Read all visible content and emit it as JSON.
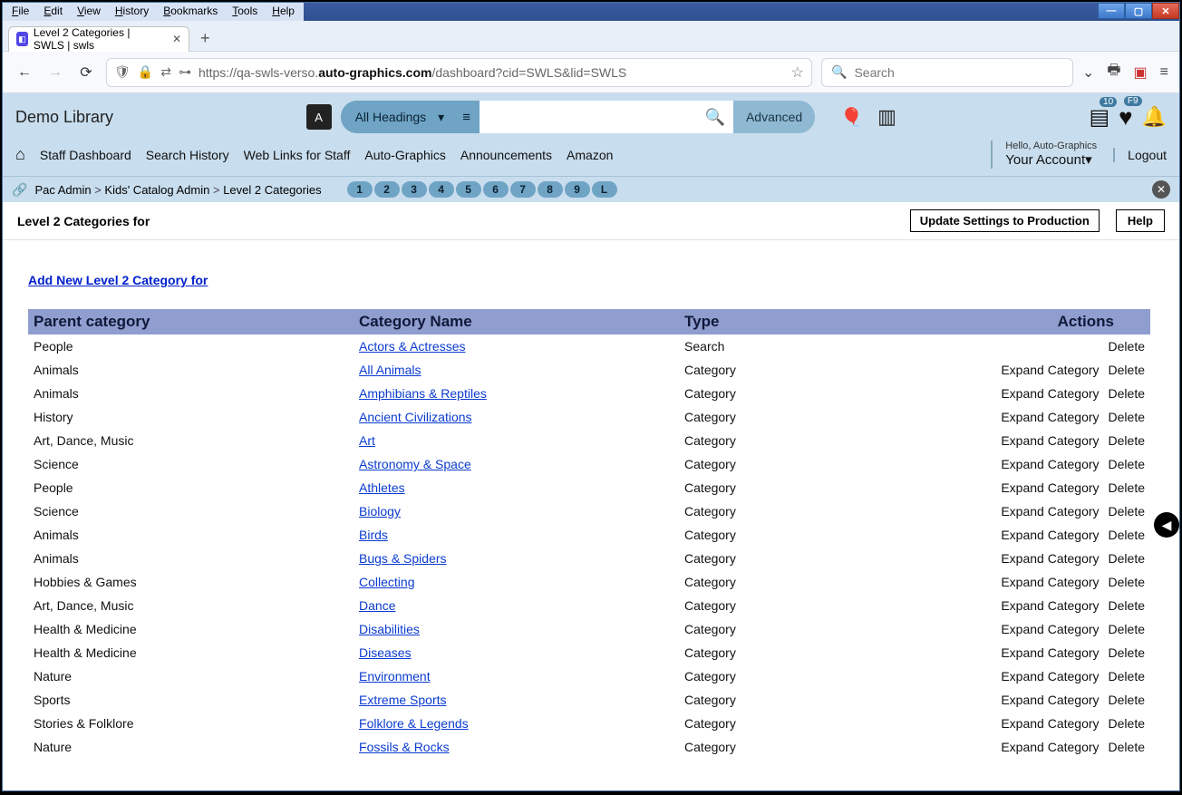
{
  "os_menu": [
    "File",
    "Edit",
    "View",
    "History",
    "Bookmarks",
    "Tools",
    "Help"
  ],
  "tab": {
    "title": "Level 2 Categories | SWLS | swls"
  },
  "url": {
    "prefix": "https://qa-swls-verso.",
    "bold": "auto-graphics.com",
    "suffix": "/dashboard?cid=SWLS&lid=SWLS"
  },
  "browser_search_placeholder": "Search",
  "app": {
    "library_name": "Demo Library",
    "headings_label": "All Headings",
    "advanced_label": "Advanced",
    "badges": {
      "list": "10",
      "fav": "F9"
    }
  },
  "nav_items": [
    "Staff Dashboard",
    "Search History",
    "Web Links for Staff",
    "Auto-Graphics",
    "Announcements",
    "Amazon"
  ],
  "account": {
    "hello": "Hello, Auto-Graphics",
    "your_account": "Your Account▾",
    "logout": "Logout"
  },
  "breadcrumb": [
    "Pac Admin",
    "Kids' Catalog Admin",
    "Level 2 Categories"
  ],
  "pages": [
    "1",
    "2",
    "3",
    "4",
    "5",
    "6",
    "7",
    "8",
    "9",
    "L"
  ],
  "page_title": "Level 2 Categories for",
  "buttons": {
    "update": "Update Settings to Production",
    "help": "Help"
  },
  "add_new": "Add New Level 2 Category for",
  "columns": {
    "parent": "Parent category",
    "name": "Category Name",
    "type": "Type",
    "actions": "Actions"
  },
  "action_labels": {
    "expand": "Expand Category",
    "delete": "Delete"
  },
  "rows": [
    {
      "parent": "People",
      "name": "Actors & Actresses",
      "type": "Search",
      "expand": false
    },
    {
      "parent": "Animals",
      "name": "All Animals",
      "type": "Category",
      "expand": true
    },
    {
      "parent": "Animals",
      "name": "Amphibians & Reptiles",
      "type": "Category",
      "expand": true
    },
    {
      "parent": "History",
      "name": "Ancient Civilizations",
      "type": "Category",
      "expand": true
    },
    {
      "parent": "Art, Dance, Music",
      "name": "Art",
      "type": "Category",
      "expand": true
    },
    {
      "parent": "Science",
      "name": "Astronomy & Space",
      "type": "Category",
      "expand": true
    },
    {
      "parent": "People",
      "name": "Athletes",
      "type": "Category",
      "expand": true
    },
    {
      "parent": "Science",
      "name": "Biology",
      "type": "Category",
      "expand": true
    },
    {
      "parent": "Animals",
      "name": "Birds",
      "type": "Category",
      "expand": true
    },
    {
      "parent": "Animals",
      "name": "Bugs & Spiders",
      "type": "Category",
      "expand": true
    },
    {
      "parent": "Hobbies & Games",
      "name": "Collecting",
      "type": "Category",
      "expand": true
    },
    {
      "parent": "Art, Dance, Music",
      "name": "Dance",
      "type": "Category",
      "expand": true
    },
    {
      "parent": "Health & Medicine",
      "name": "Disabilities",
      "type": "Category",
      "expand": true
    },
    {
      "parent": "Health & Medicine",
      "name": "Diseases",
      "type": "Category",
      "expand": true
    },
    {
      "parent": "Nature",
      "name": "Environment",
      "type": "Category",
      "expand": true
    },
    {
      "parent": "Sports",
      "name": "Extreme Sports",
      "type": "Category",
      "expand": true
    },
    {
      "parent": "Stories & Folklore",
      "name": "Folklore & Legends",
      "type": "Category",
      "expand": true
    },
    {
      "parent": "Nature",
      "name": "Fossils & Rocks",
      "type": "Category",
      "expand": true
    }
  ]
}
